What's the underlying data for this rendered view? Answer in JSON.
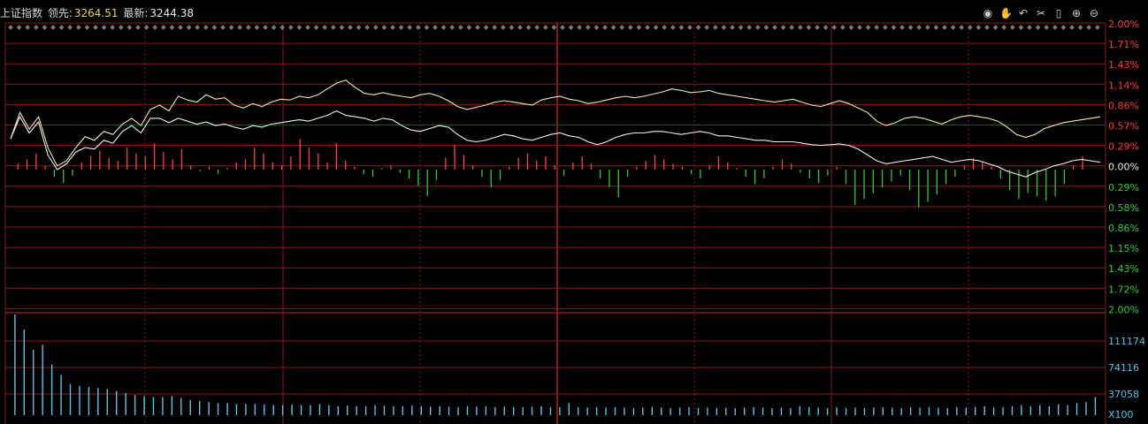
{
  "header": {
    "index_name": "上证指数",
    "leader_label": "领先:",
    "leader_value": "3264.51",
    "latest_label": "最新:",
    "latest_value": "3244.38"
  },
  "toolbar": {
    "icons": [
      "eye-icon",
      "hand-icon",
      "undo-icon",
      "scissors-icon",
      "lock-icon",
      "zoom-in-icon",
      "zoom-out-icon"
    ]
  },
  "colors": {
    "grid": "#8a1a1a",
    "up": "#ff4040",
    "down": "#2ecc2e",
    "price_line": "#f0f0f0",
    "leader_line": "#f3e9a0",
    "volume": "#57c6e6",
    "right_pct_red": "#ff3b3b",
    "right_pct_green": "#2ed12e",
    "right_vol": "#4fc3e8"
  },
  "chart_data": {
    "type": "line",
    "title": "上证指数",
    "series": [
      {
        "name": "领先",
        "values": [
          0.42,
          0.78,
          0.55,
          0.72,
          0.3,
          0.05,
          0.12,
          0.3,
          0.45,
          0.4,
          0.52,
          0.48,
          0.62,
          0.7,
          0.6,
          0.82,
          0.88,
          0.8,
          1.0,
          0.95,
          0.92,
          1.02,
          0.96,
          0.98,
          0.88,
          0.84,
          0.9,
          0.86,
          0.92,
          0.96,
          0.95,
          1.0,
          0.98,
          1.02,
          1.1,
          1.18,
          1.22,
          1.12,
          1.04,
          1.02,
          1.05,
          1.02,
          1.0,
          0.98,
          1.02,
          1.04,
          1.0,
          0.94,
          0.86,
          0.82,
          0.85,
          0.88,
          0.92,
          0.94,
          0.92,
          0.9,
          0.88,
          0.95,
          0.98,
          1.0,
          0.96,
          0.94,
          0.9,
          0.92,
          0.95,
          0.98,
          1.0,
          0.98,
          1.0,
          1.03,
          1.06,
          1.1,
          1.08,
          1.05,
          1.06,
          1.08,
          1.04,
          1.02,
          1.0,
          0.98,
          0.96,
          0.94,
          0.92,
          0.94,
          0.96,
          0.92,
          0.88,
          0.86,
          0.9,
          0.94,
          0.9,
          0.84,
          0.78,
          0.66,
          0.6,
          0.64,
          0.7,
          0.72,
          0.7,
          0.66,
          0.62,
          0.68,
          0.72,
          0.74,
          0.72,
          0.7,
          0.66,
          0.58,
          0.48,
          0.44,
          0.48,
          0.56,
          0.6,
          0.64,
          0.66,
          0.68,
          0.7,
          0.72
        ],
        "color": "#f3e9a0"
      },
      {
        "name": "最新",
        "values": [
          0.42,
          0.72,
          0.5,
          0.65,
          0.2,
          0.0,
          0.08,
          0.24,
          0.3,
          0.28,
          0.4,
          0.36,
          0.52,
          0.6,
          0.5,
          0.7,
          0.7,
          0.64,
          0.7,
          0.66,
          0.62,
          0.65,
          0.6,
          0.62,
          0.58,
          0.55,
          0.6,
          0.58,
          0.62,
          0.64,
          0.66,
          0.68,
          0.66,
          0.7,
          0.74,
          0.8,
          0.74,
          0.72,
          0.7,
          0.66,
          0.7,
          0.68,
          0.6,
          0.54,
          0.52,
          0.56,
          0.6,
          0.58,
          0.48,
          0.4,
          0.38,
          0.4,
          0.44,
          0.48,
          0.46,
          0.42,
          0.4,
          0.44,
          0.48,
          0.5,
          0.46,
          0.44,
          0.38,
          0.34,
          0.38,
          0.44,
          0.48,
          0.5,
          0.5,
          0.52,
          0.52,
          0.5,
          0.48,
          0.5,
          0.52,
          0.5,
          0.46,
          0.46,
          0.44,
          0.42,
          0.4,
          0.4,
          0.38,
          0.38,
          0.38,
          0.36,
          0.34,
          0.33,
          0.34,
          0.35,
          0.33,
          0.28,
          0.2,
          0.12,
          0.08,
          0.1,
          0.12,
          0.14,
          0.16,
          0.18,
          0.14,
          0.1,
          0.12,
          0.14,
          0.12,
          0.08,
          0.04,
          -0.02,
          -0.06,
          -0.1,
          -0.04,
          0.0,
          0.05,
          0.08,
          0.12,
          0.14,
          0.12,
          0.1
        ],
        "color": "#f0f0f0"
      }
    ],
    "breadth_bars": [
      0.08,
      0.14,
      0.22,
      0.05,
      -0.1,
      -0.18,
      -0.08,
      0.1,
      0.18,
      0.26,
      0.16,
      0.12,
      0.3,
      0.22,
      0.18,
      0.36,
      0.24,
      0.14,
      0.28,
      0.06,
      -0.02,
      0.04,
      -0.06,
      0.02,
      0.1,
      0.14,
      0.3,
      0.22,
      0.1,
      0.06,
      0.18,
      0.42,
      0.3,
      0.22,
      0.1,
      0.36,
      0.12,
      0.04,
      -0.06,
      -0.1,
      0.02,
      0.06,
      -0.04,
      -0.12,
      -0.22,
      -0.36,
      -0.14,
      0.16,
      0.34,
      0.2,
      0.06,
      -0.1,
      -0.24,
      -0.14,
      0.04,
      0.16,
      0.22,
      0.12,
      0.18,
      0.06,
      -0.08,
      0.1,
      0.18,
      0.08,
      -0.12,
      -0.24,
      -0.38,
      -0.1,
      0.04,
      0.12,
      0.2,
      0.14,
      0.08,
      0.04,
      -0.06,
      -0.12,
      0.06,
      0.18,
      0.1,
      0.02,
      -0.1,
      -0.2,
      -0.12,
      0.04,
      0.14,
      0.08,
      -0.04,
      -0.12,
      -0.18,
      -0.08,
      0.04,
      -0.2,
      -0.48,
      -0.4,
      -0.32,
      -0.24,
      -0.16,
      -0.08,
      -0.28,
      -0.52,
      -0.44,
      -0.34,
      -0.2,
      -0.1,
      0.06,
      0.16,
      0.1,
      0.04,
      -0.12,
      -0.28,
      -0.4,
      -0.32,
      -0.36,
      -0.42,
      -0.36,
      -0.2,
      0.06,
      0.18
    ],
    "volume_bars": [
      2.0,
      1.7,
      1.3,
      1.4,
      1.0,
      0.8,
      0.62,
      0.58,
      0.56,
      0.54,
      0.52,
      0.48,
      0.44,
      0.4,
      0.38,
      0.36,
      0.36,
      0.38,
      0.34,
      0.3,
      0.28,
      0.26,
      0.24,
      0.24,
      0.22,
      0.22,
      0.22,
      0.21,
      0.2,
      0.2,
      0.21,
      0.2,
      0.2,
      0.22,
      0.2,
      0.18,
      0.19,
      0.18,
      0.18,
      0.2,
      0.19,
      0.18,
      0.18,
      0.19,
      0.18,
      0.17,
      0.18,
      0.17,
      0.16,
      0.18,
      0.17,
      0.18,
      0.16,
      0.17,
      0.16,
      0.16,
      0.17,
      0.18,
      0.16,
      0.16,
      0.24,
      0.16,
      0.15,
      0.16,
      0.15,
      0.16,
      0.15,
      0.14,
      0.15,
      0.16,
      0.15,
      0.14,
      0.15,
      0.16,
      0.14,
      0.15,
      0.14,
      0.15,
      0.14,
      0.15,
      0.16,
      0.15,
      0.14,
      0.15,
      0.14,
      0.18,
      0.16,
      0.15,
      0.14,
      0.16,
      0.14,
      0.15,
      0.14,
      0.15,
      0.16,
      0.15,
      0.14,
      0.16,
      0.15,
      0.16,
      0.15,
      0.14,
      0.16,
      0.15,
      0.16,
      0.18,
      0.15,
      0.16,
      0.18,
      0.2,
      0.18,
      0.2,
      0.18,
      0.22,
      0.2,
      0.24,
      0.26,
      0.36
    ],
    "ylim": [
      -2.0,
      2.0
    ],
    "volume_ylim": [
      0,
      2.0
    ],
    "right_pct_labels": [
      "2.00%",
      "1.71%",
      "1.43%",
      "1.14%",
      "0.86%",
      "0.57%",
      "0.29%",
      "0.00%",
      "0.29%",
      "0.58%",
      "0.86%",
      "1.15%",
      "1.43%",
      "1.72%",
      "2.00%"
    ],
    "right_vol_labels": [
      "111174",
      "74116",
      "37058",
      "X100"
    ],
    "grid": true
  }
}
